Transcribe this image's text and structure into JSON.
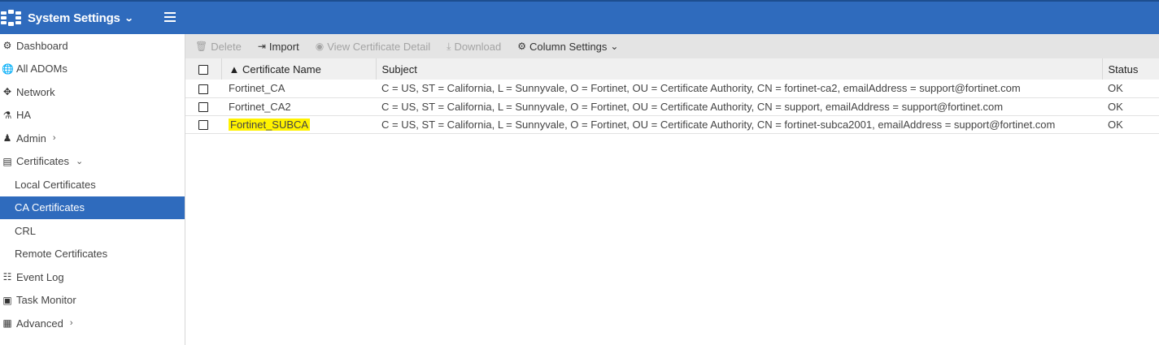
{
  "header": {
    "title": "System Settings",
    "title_chevron": "chevron-down-icon"
  },
  "sidebar": {
    "items": [
      {
        "label": "Dashboard",
        "icon": "dashboard-icon"
      },
      {
        "label": "All ADOMs",
        "icon": "globe-icon"
      },
      {
        "label": "Network",
        "icon": "network-icon"
      },
      {
        "label": "HA",
        "icon": "ha-icon"
      },
      {
        "label": "Admin",
        "icon": "user-icon",
        "chevron": "›"
      },
      {
        "label": "Certificates",
        "icon": "certificate-icon",
        "chevron": "⌄"
      },
      {
        "label": "Local Certificates"
      },
      {
        "label": "CA Certificates",
        "active": true
      },
      {
        "label": "CRL"
      },
      {
        "label": "Remote Certificates"
      },
      {
        "label": "Event Log",
        "icon": "event-log-icon"
      },
      {
        "label": "Task Monitor",
        "icon": "task-monitor-icon"
      },
      {
        "label": "Advanced",
        "icon": "advanced-icon",
        "chevron": "›"
      }
    ]
  },
  "toolbar": {
    "delete_label": "Delete",
    "import_label": "Import",
    "view_label": "View Certificate Detail",
    "download_label": "Download",
    "column_settings_label": "Column Settings"
  },
  "table": {
    "headers": {
      "name": "Certificate Name",
      "sort_indicator": "▲",
      "subject": "Subject",
      "status": "Status"
    },
    "rows": [
      {
        "name": "Fortinet_CA",
        "subject": "C = US, ST = California, L = Sunnyvale, O = Fortinet, OU = Certificate Authority, CN = fortinet-ca2, emailAddress = support@fortinet.com",
        "status": "OK",
        "highlighted": false
      },
      {
        "name": "Fortinet_CA2",
        "subject": "C = US, ST = California, L = Sunnyvale, O = Fortinet, OU = Certificate Authority, CN = support, emailAddress = support@fortinet.com",
        "status": "OK",
        "highlighted": false
      },
      {
        "name": "Fortinet_SUBCA",
        "subject": "C = US, ST = California, L = Sunnyvale, O = Fortinet, OU = Certificate Authority, CN = fortinet-subca2001, emailAddress = support@fortinet.com",
        "status": "OK",
        "highlighted": true
      }
    ]
  },
  "colors": {
    "accent": "#2f6bbd",
    "highlight": "#fff200"
  }
}
